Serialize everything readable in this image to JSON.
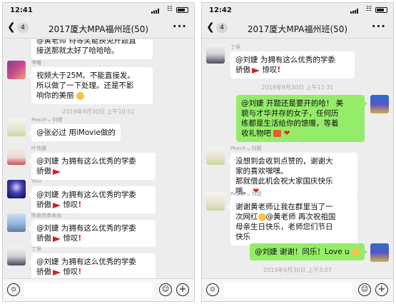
{
  "left": {
    "status": {
      "time": "12:41"
    },
    "nav": {
      "badge": "4",
      "title": "2017厦大MPA福州班(50)"
    },
    "messages": {
      "m1": {
        "line1": "@黄老师 特等奖能换免升题直",
        "line2": "接送那就太好了哈哈哈。"
      },
      "m2": {
        "sender": "李曦",
        "line1": "视频大于25M。不能直接发。",
        "line2": "所以做了一下处理。还是不影",
        "line3": "响你的美丽"
      },
      "ts1": "2019年9月30日 上午10:51",
      "m3": {
        "sender": "Peach·ᴗ·刘婕",
        "line1": "@张必过 用iMovie做的"
      },
      "m4": {
        "sender": "叶伟娜",
        "line1": "@刘婕 为拥有这么优秀的学委",
        "line2": "骄傲"
      },
      "m5": {
        "sender": "Yolo",
        "line1": "@刘婕 为拥有这么优秀的学委",
        "line2": "骄傲",
        "line2b": "惊叹"
      },
      "m6": {
        "sender": "陈景扬勇善战",
        "line1": "@刘婕 为拥有这么优秀的学委",
        "line2": "骄傲",
        "line2b": "惊叹"
      },
      "m7": {
        "sender": "丁俣",
        "line1": "@刘婕 为拥有这么优秀的学委",
        "line2": "骄傲",
        "line2b": "惊叹"
      }
    }
  },
  "right": {
    "status": {
      "time": "12:42"
    },
    "nav": {
      "badge": "4",
      "title": "2017厦大MPA福州班(50)"
    },
    "messages": {
      "r1": {
        "sender": "丁俣",
        "line1": "@刘婕 为拥有这么优秀的学委",
        "line2": "骄傲",
        "line2b": "惊叹"
      },
      "ts1": "2019年9月30日 上午11:31",
      "r2": {
        "line1": "@刘婕 开题还是要开的哈！ 美",
        "line2": "貌与才华并存的女子，任何历",
        "line3": "练都是生活给你的馈赠，等着",
        "line4": "收礼物吧"
      },
      "r3": {
        "sender": "Peach·ᴗ·刘婕",
        "line1": "没想到会收到点赞的，谢谢大",
        "line2": "家的喜欢嘿嘿。",
        "line3": "那就借此机会祝大家国庆快乐",
        "line4": "哦。"
      },
      "r4": {
        "sender": "Peach·ᴗ·刘婕",
        "line1": "谢谢黄老师让我在群里当了一",
        "line2": "次网红",
        "line2b": "@黄老师 再次祝祖国",
        "line3": "母亲生日快乐，老师您们节日",
        "line4": "快乐"
      },
      "r5": {
        "line1": "@刘婕 谢谢！同乐！Love u"
      },
      "ts2": "2019年9月30日 上午3:07"
    }
  },
  "icons": {
    "back": "chevron-left-icon",
    "more": "ellipsis-icon",
    "voice": "voice-icon",
    "emoji": "emoji-icon",
    "plus": "plus-icon"
  },
  "colors": {
    "chat_bg": "#ededed",
    "my_bubble": "#95ec69",
    "other_bubble": "#ffffff",
    "flag": "#d82020"
  }
}
